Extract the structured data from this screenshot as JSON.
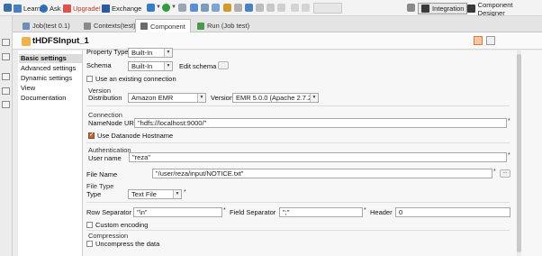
{
  "toolbar": {
    "learn": "Learn",
    "ask": "Ask",
    "upgrade": "Upgrade!",
    "exchange": "Exchange",
    "integration": "Integration",
    "component_designer": "Component Designer"
  },
  "tabs": {
    "job": "Job(test 0.1)",
    "contexts": "Contexts(test)",
    "component": "Component",
    "run": "Run (Job test)"
  },
  "component": {
    "title": "tHDFSInput_1"
  },
  "nav": {
    "items": [
      "Basic settings",
      "Advanced settings",
      "Dynamic settings",
      "View",
      "Documentation"
    ]
  },
  "form": {
    "property_type": {
      "label": "Property Type",
      "value": "Built-In"
    },
    "schema": {
      "label": "Schema",
      "value": "Built-In",
      "edit": "Edit schema"
    },
    "existing_connection": "Use an existing connection",
    "version": {
      "section": "Version",
      "distribution_label": "Distribution",
      "distribution_value": "Amazon EMR",
      "version_label": "Version",
      "version_value": "EMR 5.0.0 (Apache 2.7.2)"
    },
    "connection": {
      "section": "Connection",
      "namenode_label": "NameNode URI",
      "namenode_value": "\"hdfs://localhost:9000/\"",
      "datanode_hostname": "Use Datanode Hostname"
    },
    "authentication": {
      "section": "Authentication",
      "username_label": "User name",
      "username_value": "\"reza\""
    },
    "file": {
      "label": "File Name",
      "value": "\"/user/reza/input/NOTICE.txt\""
    },
    "file_type": {
      "section": "File Type",
      "label": "Type",
      "value": "Text File"
    },
    "row_separator": {
      "label": "Row Separator",
      "value": "\"\\n\""
    },
    "field_separator": {
      "label": "Field Separator",
      "value": "\";\""
    },
    "header": {
      "label": "Header",
      "value": "0"
    },
    "custom_encoding": "Custom encoding",
    "compression": {
      "section": "Compression",
      "uncompress": "Uncompress the data"
    },
    "required_mark": "*",
    "browse": "..."
  },
  "colors": {
    "selected_check": "#b8663c",
    "upgrade": "#c0392b"
  }
}
